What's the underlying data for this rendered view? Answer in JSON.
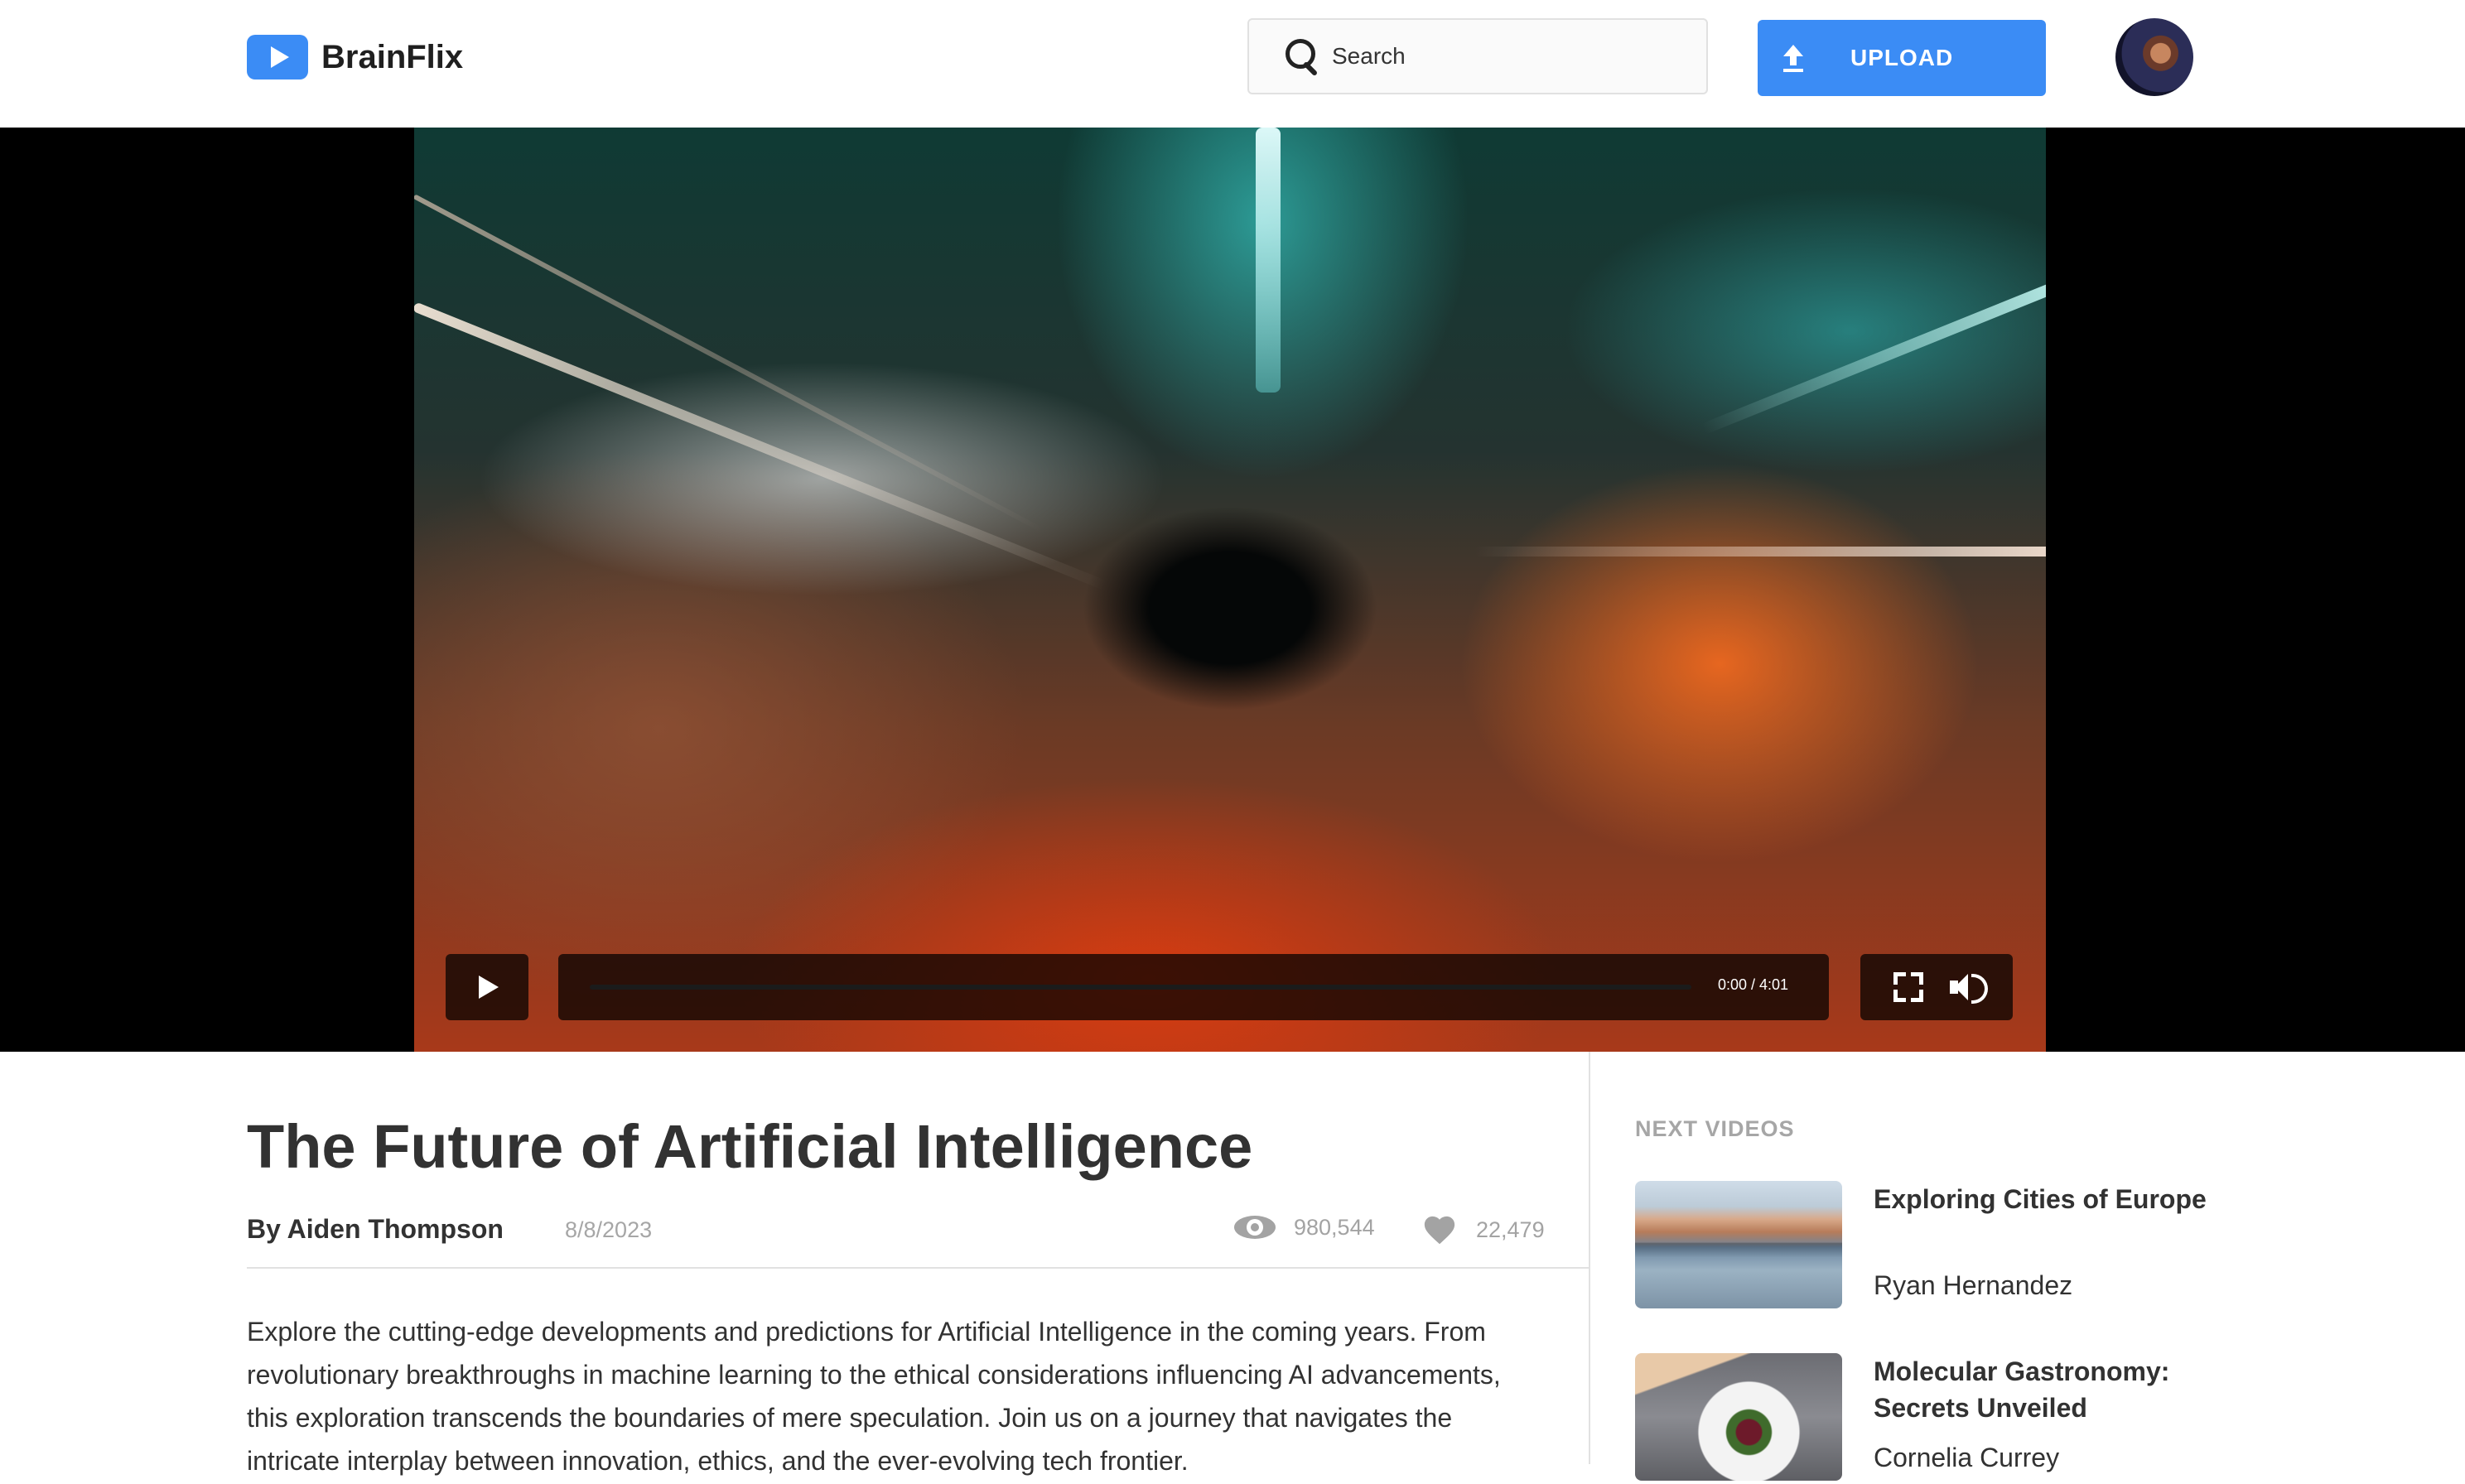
{
  "app": {
    "name": "BrainFlix",
    "accent_color": "#3b8cf5"
  },
  "header": {
    "search_placeholder": "Search",
    "upload_label": "UPLOAD",
    "icons": {
      "logo": "play-logo-icon",
      "search": "search-icon",
      "upload": "upload-icon"
    }
  },
  "player": {
    "time": "0:00 / 4:01",
    "progress": 0,
    "icons": {
      "play": "play-icon",
      "fullscreen": "fullscreen-icon",
      "volume": "volume-icon"
    }
  },
  "video": {
    "title": "The Future of Artificial Intelligence",
    "author": "By Aiden Thompson",
    "date": "8/8/2023",
    "views": "980,544",
    "likes": "22,479",
    "description": "Explore the cutting-edge developments and predictions for Artificial Intelligence in the coming years. From revolutionary breakthroughs in machine learning to the ethical considerations influencing AI advancements, this exploration transcends the boundaries of mere speculation. Join us on a journey that navigates the intricate interplay between innovation, ethics, and the ever-evolving tech frontier."
  },
  "next_videos": {
    "heading": "NEXT VIDEOS",
    "items": [
      {
        "title": "Exploring Cities of Europe",
        "channel": "Ryan Hernandez"
      },
      {
        "title": "Molecular Gastronomy: Secrets Unveiled",
        "channel": "Cornelia Currey"
      }
    ]
  }
}
